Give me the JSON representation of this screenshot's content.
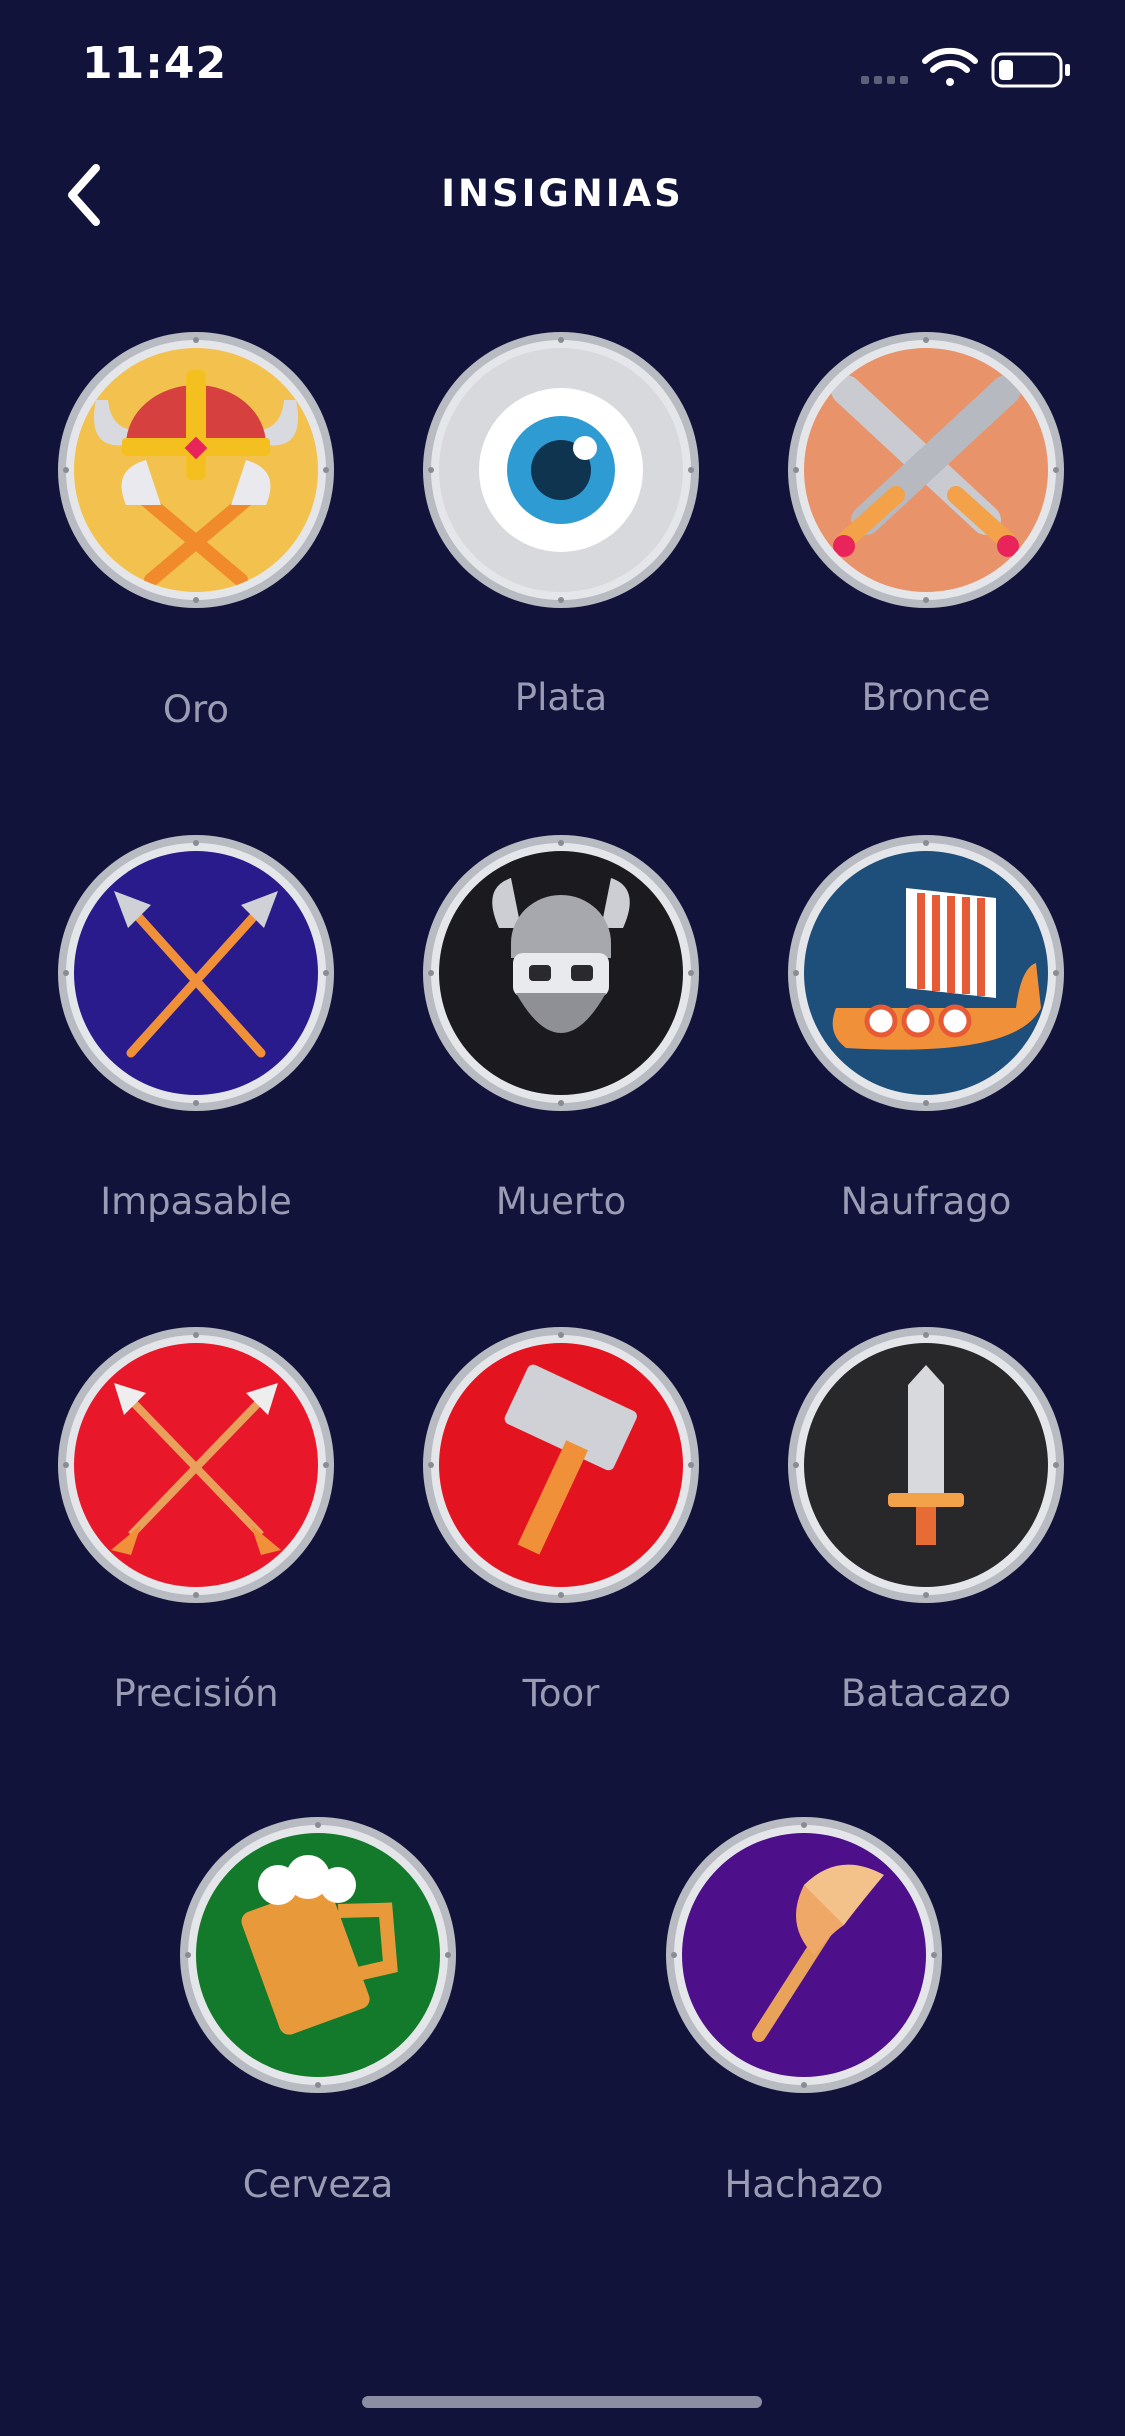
{
  "status": {
    "time": "11:42"
  },
  "header": {
    "title": "INSIGNIAS"
  },
  "badges": [
    {
      "name": "Oro",
      "fill": "#f2c14e",
      "icon": "viking-helmet-axes-icon"
    },
    {
      "name": "Plata",
      "fill": "#d7d9dd",
      "icon": "eye-icon"
    },
    {
      "name": "Bronce",
      "fill": "#e8936a",
      "icon": "crossed-swords-icon"
    },
    {
      "name": "Impasable",
      "fill": "#2a1b8c",
      "icon": "crossed-spears-icon"
    },
    {
      "name": "Muerto",
      "fill": "#1b1b1f",
      "icon": "viking-skull-icon"
    },
    {
      "name": "Naufrago",
      "fill": "#1e4e7a",
      "icon": "viking-ship-icon"
    },
    {
      "name": "Precisión",
      "fill": "#e8182a",
      "icon": "crossed-arrows-icon"
    },
    {
      "name": "Toor",
      "fill": "#e41320",
      "icon": "hammer-icon"
    },
    {
      "name": "Batacazo",
      "fill": "#28282b",
      "icon": "sword-icon"
    },
    {
      "name": "Cerveza",
      "fill": "#127a2a",
      "icon": "beer-mug-icon"
    },
    {
      "name": "Hachazo",
      "fill": "#4e0f8a",
      "icon": "battle-axe-icon"
    }
  ]
}
